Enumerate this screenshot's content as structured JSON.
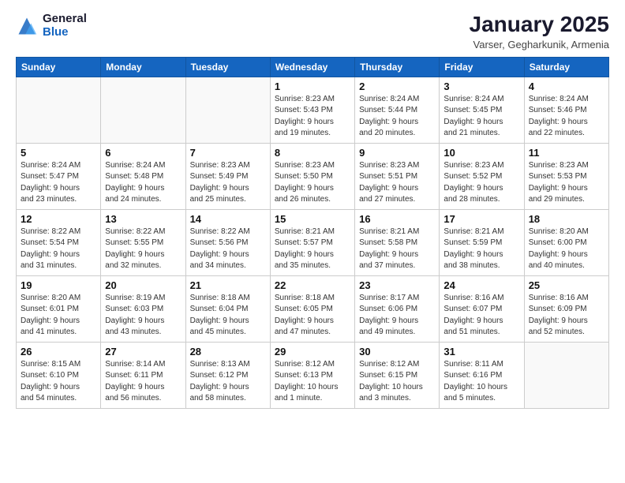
{
  "logo": {
    "general": "General",
    "blue": "Blue"
  },
  "header": {
    "title": "January 2025",
    "subtitle": "Varser, Gegharkunik, Armenia"
  },
  "weekdays": [
    "Sunday",
    "Monday",
    "Tuesday",
    "Wednesday",
    "Thursday",
    "Friday",
    "Saturday"
  ],
  "weeks": [
    [
      {
        "day": "",
        "info": ""
      },
      {
        "day": "",
        "info": ""
      },
      {
        "day": "",
        "info": ""
      },
      {
        "day": "1",
        "info": "Sunrise: 8:23 AM\nSunset: 5:43 PM\nDaylight: 9 hours\nand 19 minutes."
      },
      {
        "day": "2",
        "info": "Sunrise: 8:24 AM\nSunset: 5:44 PM\nDaylight: 9 hours\nand 20 minutes."
      },
      {
        "day": "3",
        "info": "Sunrise: 8:24 AM\nSunset: 5:45 PM\nDaylight: 9 hours\nand 21 minutes."
      },
      {
        "day": "4",
        "info": "Sunrise: 8:24 AM\nSunset: 5:46 PM\nDaylight: 9 hours\nand 22 minutes."
      }
    ],
    [
      {
        "day": "5",
        "info": "Sunrise: 8:24 AM\nSunset: 5:47 PM\nDaylight: 9 hours\nand 23 minutes."
      },
      {
        "day": "6",
        "info": "Sunrise: 8:24 AM\nSunset: 5:48 PM\nDaylight: 9 hours\nand 24 minutes."
      },
      {
        "day": "7",
        "info": "Sunrise: 8:23 AM\nSunset: 5:49 PM\nDaylight: 9 hours\nand 25 minutes."
      },
      {
        "day": "8",
        "info": "Sunrise: 8:23 AM\nSunset: 5:50 PM\nDaylight: 9 hours\nand 26 minutes."
      },
      {
        "day": "9",
        "info": "Sunrise: 8:23 AM\nSunset: 5:51 PM\nDaylight: 9 hours\nand 27 minutes."
      },
      {
        "day": "10",
        "info": "Sunrise: 8:23 AM\nSunset: 5:52 PM\nDaylight: 9 hours\nand 28 minutes."
      },
      {
        "day": "11",
        "info": "Sunrise: 8:23 AM\nSunset: 5:53 PM\nDaylight: 9 hours\nand 29 minutes."
      }
    ],
    [
      {
        "day": "12",
        "info": "Sunrise: 8:22 AM\nSunset: 5:54 PM\nDaylight: 9 hours\nand 31 minutes."
      },
      {
        "day": "13",
        "info": "Sunrise: 8:22 AM\nSunset: 5:55 PM\nDaylight: 9 hours\nand 32 minutes."
      },
      {
        "day": "14",
        "info": "Sunrise: 8:22 AM\nSunset: 5:56 PM\nDaylight: 9 hours\nand 34 minutes."
      },
      {
        "day": "15",
        "info": "Sunrise: 8:21 AM\nSunset: 5:57 PM\nDaylight: 9 hours\nand 35 minutes."
      },
      {
        "day": "16",
        "info": "Sunrise: 8:21 AM\nSunset: 5:58 PM\nDaylight: 9 hours\nand 37 minutes."
      },
      {
        "day": "17",
        "info": "Sunrise: 8:21 AM\nSunset: 5:59 PM\nDaylight: 9 hours\nand 38 minutes."
      },
      {
        "day": "18",
        "info": "Sunrise: 8:20 AM\nSunset: 6:00 PM\nDaylight: 9 hours\nand 40 minutes."
      }
    ],
    [
      {
        "day": "19",
        "info": "Sunrise: 8:20 AM\nSunset: 6:01 PM\nDaylight: 9 hours\nand 41 minutes."
      },
      {
        "day": "20",
        "info": "Sunrise: 8:19 AM\nSunset: 6:03 PM\nDaylight: 9 hours\nand 43 minutes."
      },
      {
        "day": "21",
        "info": "Sunrise: 8:18 AM\nSunset: 6:04 PM\nDaylight: 9 hours\nand 45 minutes."
      },
      {
        "day": "22",
        "info": "Sunrise: 8:18 AM\nSunset: 6:05 PM\nDaylight: 9 hours\nand 47 minutes."
      },
      {
        "day": "23",
        "info": "Sunrise: 8:17 AM\nSunset: 6:06 PM\nDaylight: 9 hours\nand 49 minutes."
      },
      {
        "day": "24",
        "info": "Sunrise: 8:16 AM\nSunset: 6:07 PM\nDaylight: 9 hours\nand 51 minutes."
      },
      {
        "day": "25",
        "info": "Sunrise: 8:16 AM\nSunset: 6:09 PM\nDaylight: 9 hours\nand 52 minutes."
      }
    ],
    [
      {
        "day": "26",
        "info": "Sunrise: 8:15 AM\nSunset: 6:10 PM\nDaylight: 9 hours\nand 54 minutes."
      },
      {
        "day": "27",
        "info": "Sunrise: 8:14 AM\nSunset: 6:11 PM\nDaylight: 9 hours\nand 56 minutes."
      },
      {
        "day": "28",
        "info": "Sunrise: 8:13 AM\nSunset: 6:12 PM\nDaylight: 9 hours\nand 58 minutes."
      },
      {
        "day": "29",
        "info": "Sunrise: 8:12 AM\nSunset: 6:13 PM\nDaylight: 10 hours\nand 1 minute."
      },
      {
        "day": "30",
        "info": "Sunrise: 8:12 AM\nSunset: 6:15 PM\nDaylight: 10 hours\nand 3 minutes."
      },
      {
        "day": "31",
        "info": "Sunrise: 8:11 AM\nSunset: 6:16 PM\nDaylight: 10 hours\nand 5 minutes."
      },
      {
        "day": "",
        "info": ""
      }
    ]
  ]
}
